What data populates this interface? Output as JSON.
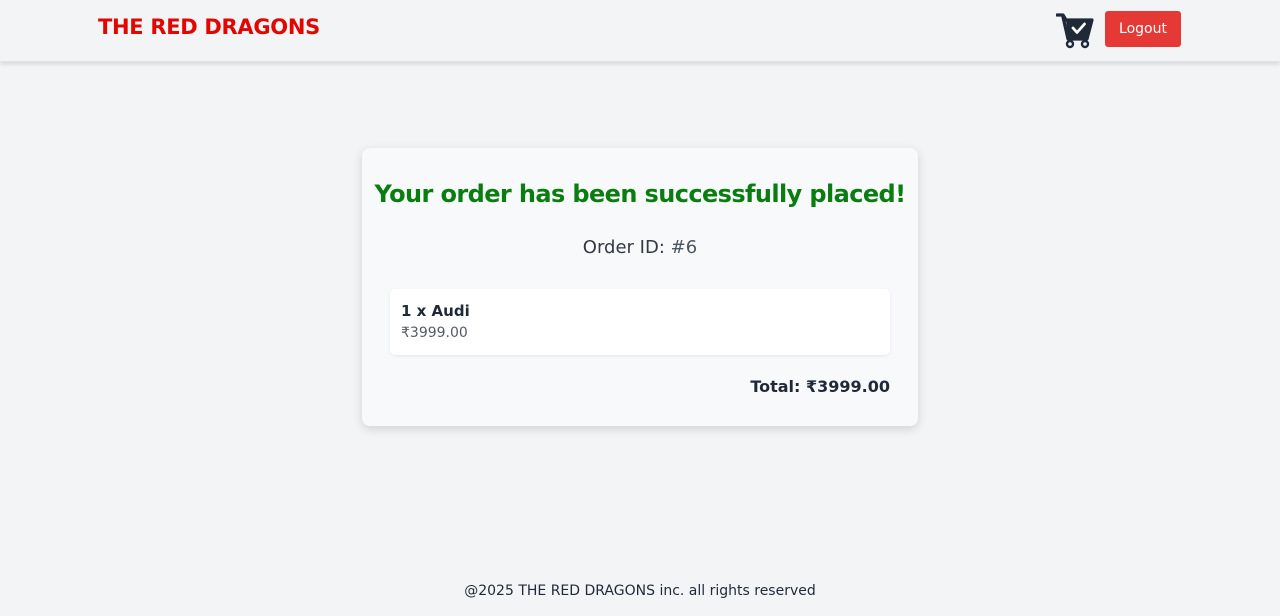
{
  "header": {
    "brand": "THE RED DRAGONS",
    "cart_icon": "cart-check-icon",
    "logout_label": "Logout"
  },
  "order": {
    "title": "Your order has been successfully placed!",
    "id_label": "Order ID:",
    "id_value": "#6",
    "items": [
      {
        "name": "1 x Audi",
        "price": "₹3999.00"
      }
    ],
    "total": "Total: ₹3999.00"
  },
  "footer": {
    "text": "@2025 THE RED DRAGONS inc. all rights reserved"
  },
  "colors": {
    "brand": "#e10600",
    "success": "#0a7d11",
    "logout_bg": "#e53935",
    "page_bg": "#f3f4f6"
  }
}
